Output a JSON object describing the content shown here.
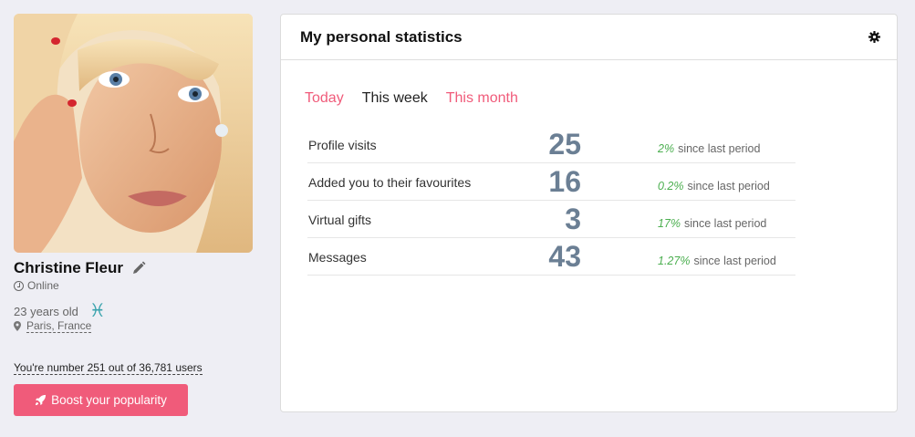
{
  "profile": {
    "name": "Christine Fleur",
    "status": "Online",
    "age": "23 years old",
    "zodiac_glyph": "♓",
    "location": "Paris, France",
    "rank": "You're number 251 out of 36,781 users",
    "boost_label": "Boost your popularity"
  },
  "stats_card": {
    "title": "My personal statistics",
    "tabs": [
      {
        "label": "Today",
        "active": false
      },
      {
        "label": "This week",
        "active": true
      },
      {
        "label": "This month",
        "active": false
      }
    ],
    "rows": [
      {
        "label": "Profile visits",
        "value": "25",
        "change": "2%",
        "suffix": "since last period"
      },
      {
        "label": "Added you to their favourites",
        "value": "16",
        "change": "0.2%",
        "suffix": "since last period"
      },
      {
        "label": "Virtual gifts",
        "value": "3",
        "change": "17%",
        "suffix": "since last period"
      },
      {
        "label": "Messages",
        "value": "43",
        "change": "1.27%",
        "suffix": "since last period"
      }
    ]
  },
  "colors": {
    "accent": "#f05b7a",
    "stat_value": "#6b7f94",
    "positive": "#4caf50",
    "zodiac": "#3aa3ad"
  }
}
